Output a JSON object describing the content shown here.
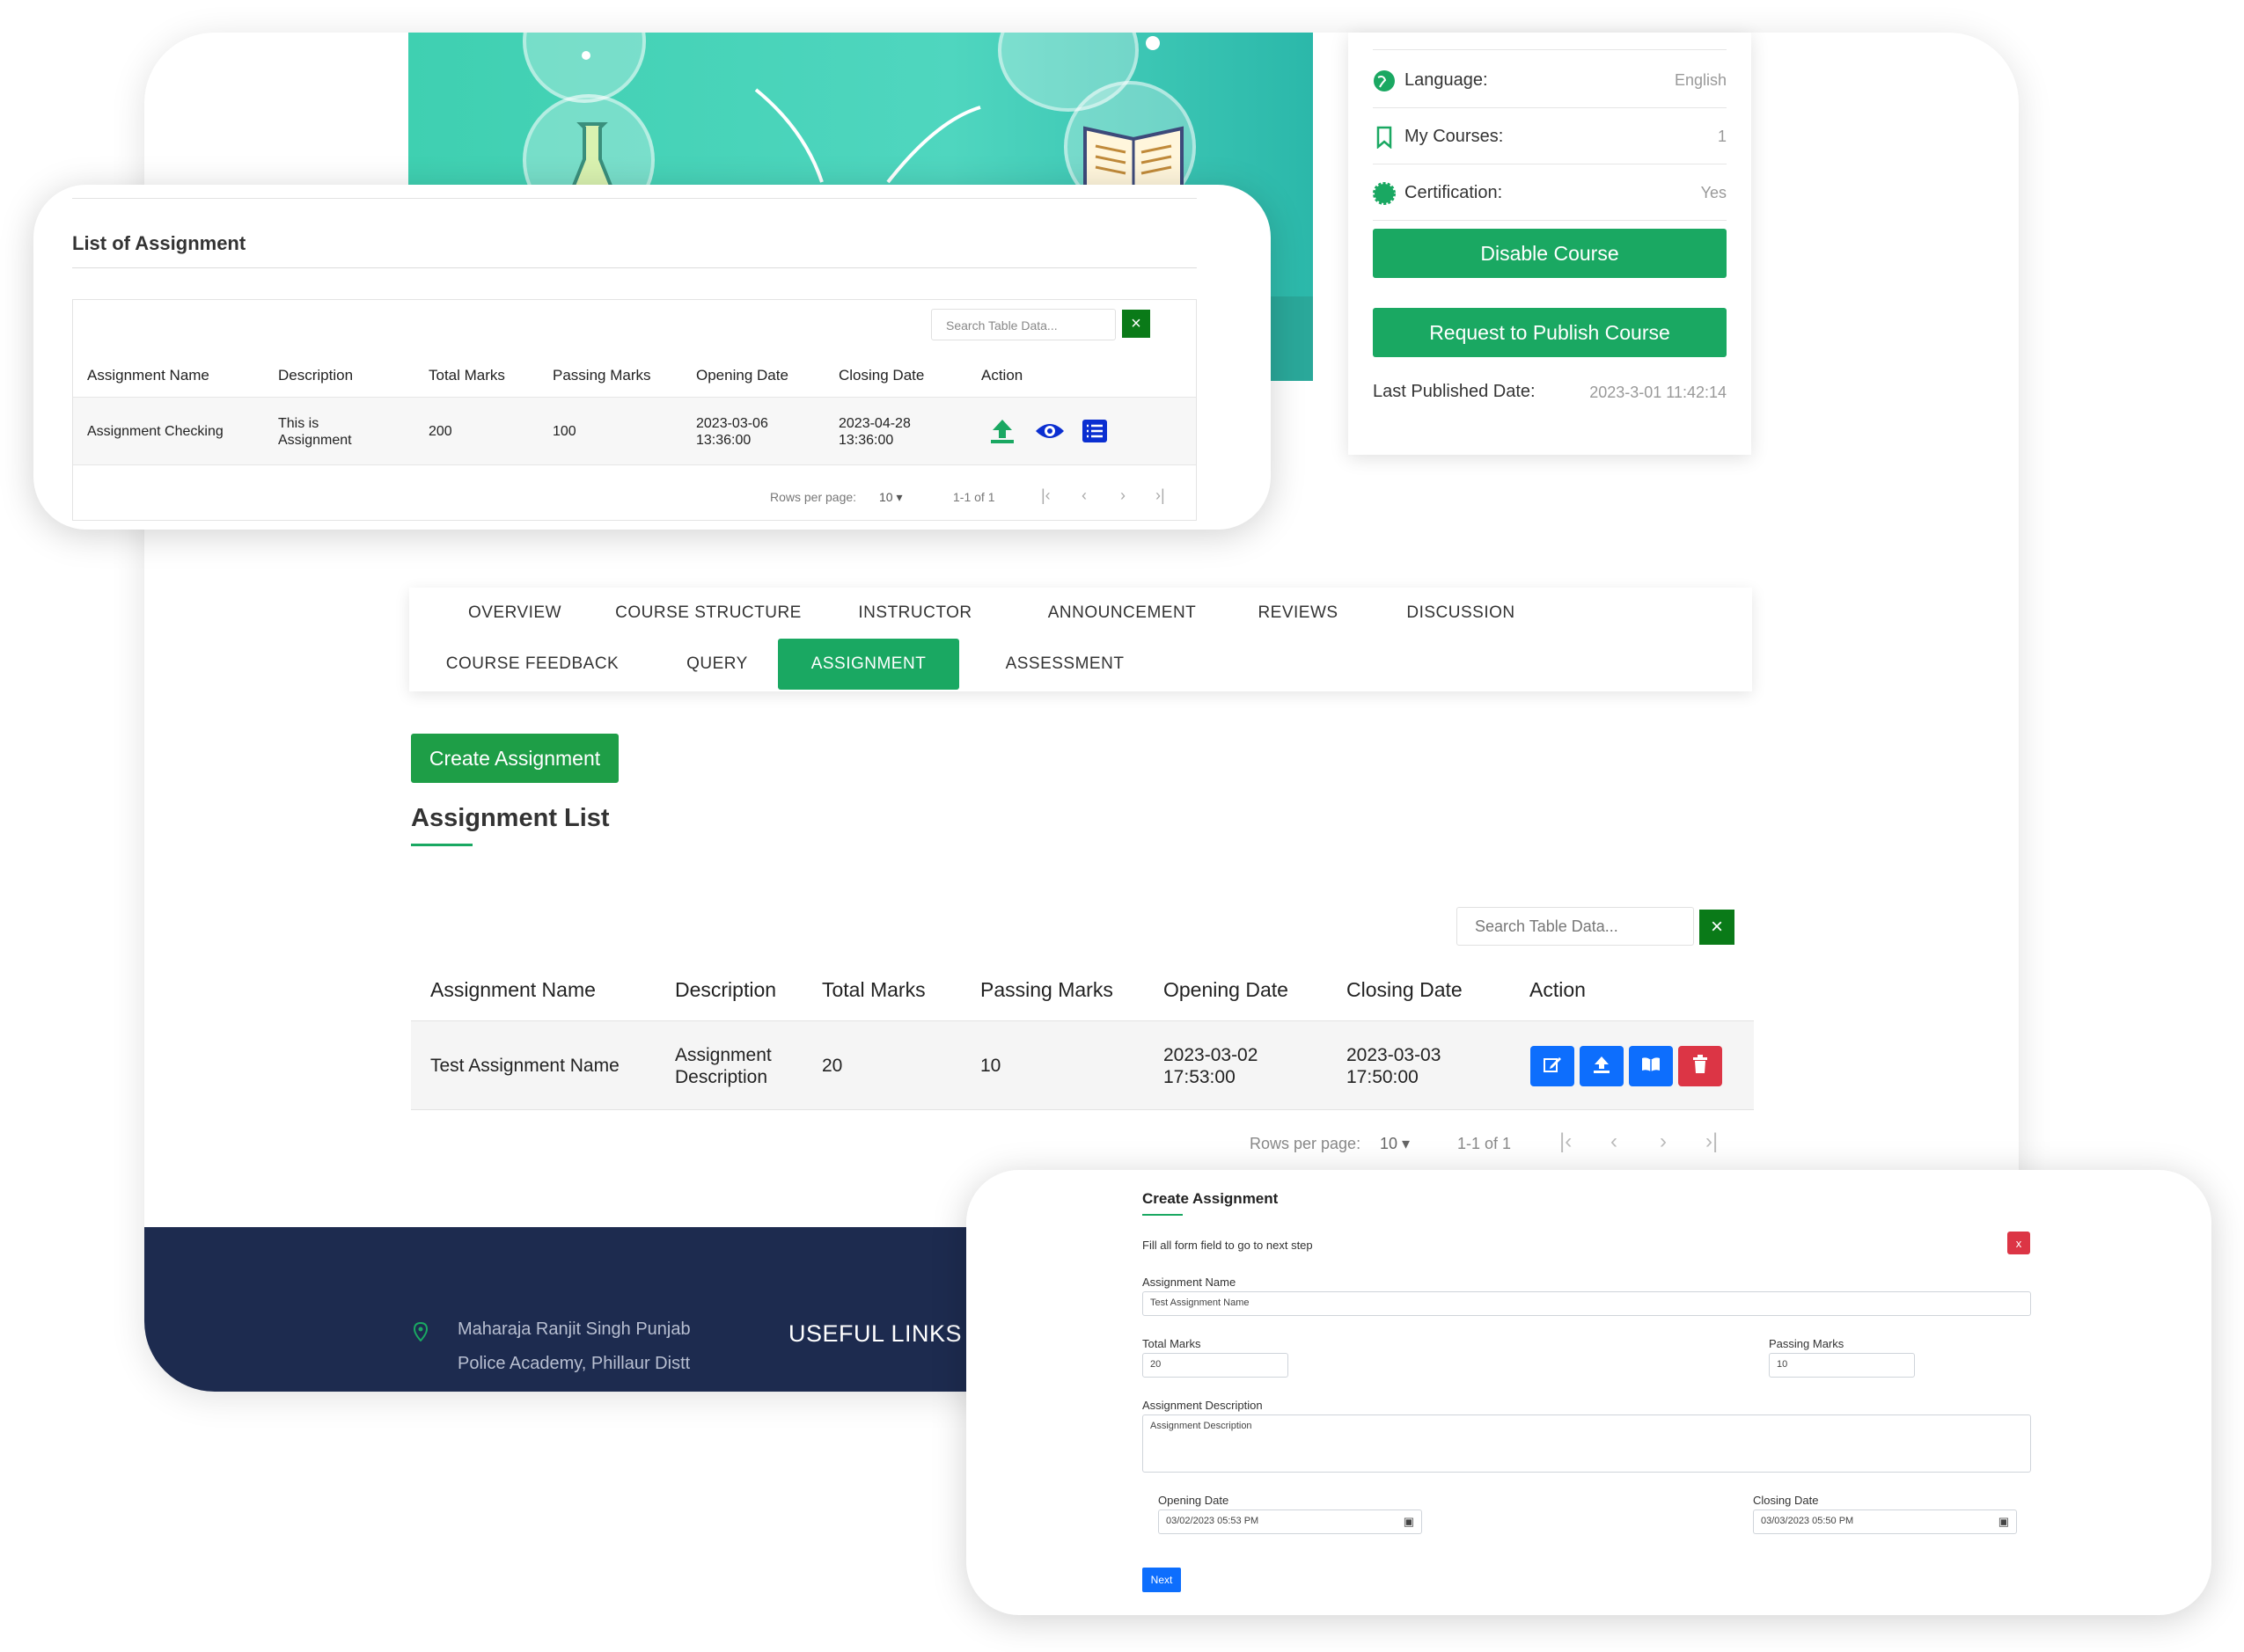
{
  "info": {
    "language_label": "Language:",
    "language_value": "English",
    "mycourses_label": "My Courses:",
    "mycourses_value": "1",
    "certification_label": "Certification:",
    "certification_value": "Yes",
    "disable_btn": "Disable Course",
    "publish_btn": "Request to Publish Course",
    "last_published_label": "Last Published Date:",
    "last_published_value": "2023-3-01 11:42:14"
  },
  "loa": {
    "title": "List of Assignment",
    "search_placeholder": "Search Table Data...",
    "clear_icon": "×",
    "headers": [
      "Assignment Name",
      "Description",
      "Total Marks",
      "Passing Marks",
      "Opening Date",
      "Closing Date",
      "Action"
    ],
    "row": {
      "name": "Assignment Checking",
      "description": "This is Assignment",
      "total": "200",
      "passing": "100",
      "opening": "2023-03-06 13:36:00",
      "closing": "2023-04-28 13:36:00"
    },
    "pagination": {
      "rows_label": "Rows per page:",
      "rows_value": "10",
      "range": "1-1 of 1"
    }
  },
  "tabs": [
    "OVERVIEW",
    "COURSE STRUCTURE",
    "INSTRUCTOR",
    "ANNOUNCEMENT",
    "REVIEWS",
    "DISCUSSION",
    "COURSE FEEDBACK",
    "QUERY",
    "ASSIGNMENT",
    "ASSESSMENT"
  ],
  "assignment": {
    "create_btn": "Create Assignment",
    "title": "Assignment List",
    "search_placeholder": "Search Table Data...",
    "headers": [
      "Assignment Name",
      "Description",
      "Total Marks",
      "Passing Marks",
      "Opening Date",
      "Closing Date",
      "Action"
    ],
    "row": {
      "name": "Test Assignment Name",
      "description": "Assignment Description",
      "total": "20",
      "passing": "10",
      "opening": "2023-03-02 17:53:00",
      "closing": "2023-03-03 17:50:00"
    },
    "pagination": {
      "rows_label": "Rows per page:",
      "rows_value": "10",
      "range": "1-1 of 1"
    }
  },
  "footer": {
    "address": "Maharaja Ranjit Singh Punjab Police Academy, Phillaur Distt",
    "useful_links": "USEFUL LINKS"
  },
  "create_form": {
    "title": "Create Assignment",
    "subtitle": "Fill all form field to go to next step",
    "close": "x",
    "name_label": "Assignment Name",
    "name_value": "Test Assignment Name",
    "total_label": "Total Marks",
    "total_value": "20",
    "passing_label": "Passing Marks",
    "passing_value": "10",
    "desc_label": "Assignment Description",
    "desc_value": "Assignment Description",
    "opening_label": "Opening Date",
    "opening_value": "03/02/2023 05:53 PM",
    "closing_label": "Closing Date",
    "closing_value": "03/03/2023 05:50 PM",
    "next_btn": "Next"
  },
  "colors": {
    "green": "#1aa862",
    "blue": "#0d6efd",
    "red": "#dc3545",
    "navy": "#1d2b4f"
  }
}
